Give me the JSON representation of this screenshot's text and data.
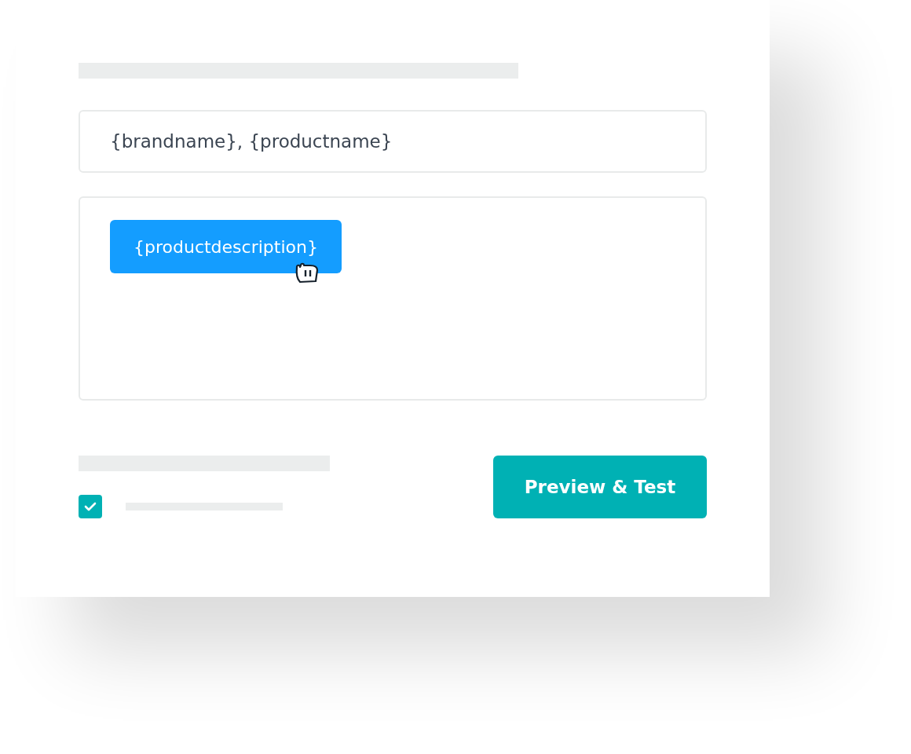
{
  "subject_field": {
    "value": "{brandname}, {productname}"
  },
  "body_field": {
    "tokens": [
      "{productdescription}"
    ]
  },
  "option": {
    "checked": true
  },
  "preview_button": {
    "label": "Preview & Test"
  }
}
